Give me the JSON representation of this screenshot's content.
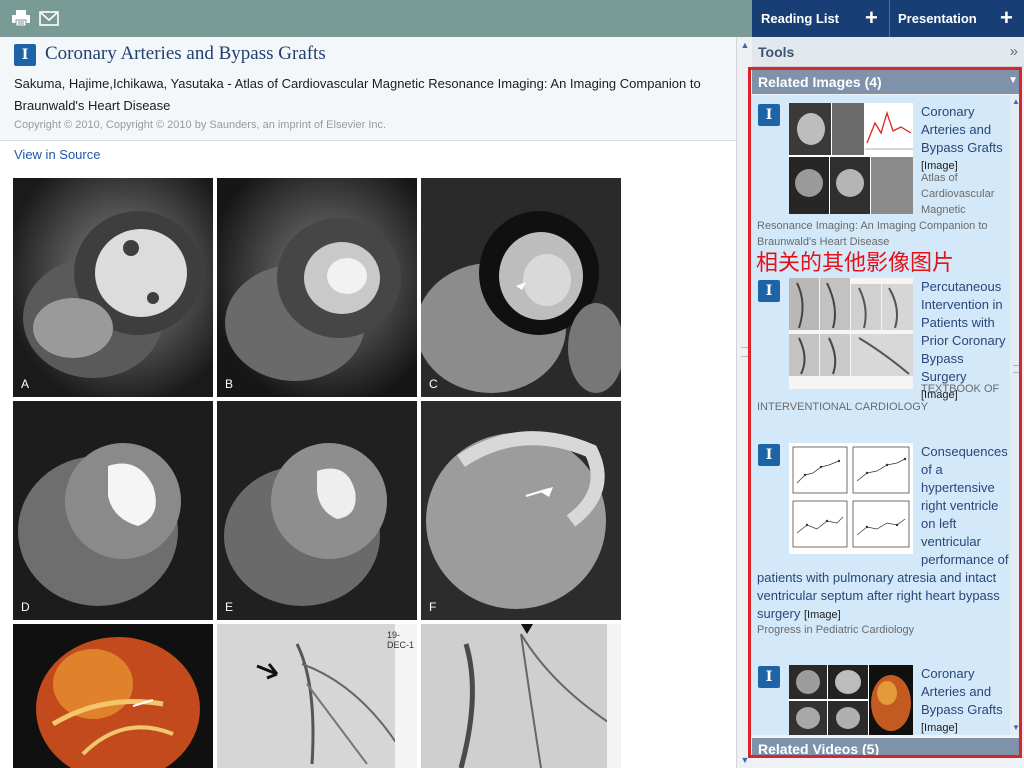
{
  "toolbar": {
    "print_icon": "print-icon",
    "email_icon": "email-icon"
  },
  "document": {
    "badge": "I",
    "title": "Coronary Arteries and Bypass Grafts",
    "citation": "Sakuma, Hajime,Ichikawa, Yasutaka - Atlas of Cardiovascular Magnetic Resonance Imaging: An Imaging Companion to Braunwald's Heart Disease",
    "copyright": "Copyright © 2010, Copyright © 2010 by Saunders, an imprint of Elsevier Inc.",
    "view_source": "View in Source"
  },
  "figure": {
    "panel_labels": [
      "A",
      "B",
      "C",
      "D",
      "E",
      "F"
    ],
    "angio_label": "19-DEC-1"
  },
  "sidebar": {
    "reading_list": "Reading List",
    "presentation": "Presentation",
    "plus": "+",
    "tools": "Tools",
    "tools_chevron": "»",
    "related_images_header": "Related Images (4)",
    "related_videos_header": "Related Videos (5)"
  },
  "related_images": [
    {
      "title": "Coronary Arteries and Bypass Grafts",
      "tag": "[Image]",
      "source_wrapped": "Atlas of Cardiovascular Magnetic",
      "source_cont": "Resonance Imaging: An Imaging Companion to Braunwald's Heart Disease"
    },
    {
      "title": "Percutaneous Intervention in Patients with Prior Coronary Bypass Surgery",
      "tag": "[Image]",
      "source_wrapped": "TEXTBOOK OF",
      "source_cont": "INTERVENTIONAL CARDIOLOGY"
    },
    {
      "title": "Consequences of a hypertensive right ventricle on left ventricular performance of",
      "title_cont": "patients with pulmonary atresia and intact ventricular septum after right heart bypass surgery",
      "tag": "[Image]",
      "source": "Progress in Pediatric Cardiology"
    },
    {
      "title": "Coronary Arteries and Bypass Grafts",
      "tag": "[Image]"
    }
  ],
  "annotation": "相关的其他影像图片",
  "colors": {
    "topbar": "#7a9a96",
    "sidebar_bar": "#173f75",
    "link": "#1f58a8",
    "highlight_frame": "#d9252a",
    "list_bg": "#d3e8f8"
  }
}
